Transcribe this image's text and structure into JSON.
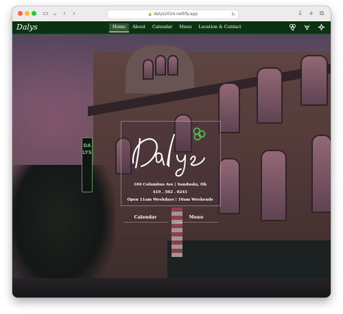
{
  "browser": {
    "url": "dalys2024.netlify.app",
    "icons": {
      "sidebar": "sidebar-icon",
      "back": "chevron-left-icon",
      "forward": "chevron-right-icon",
      "reload": "reload-icon",
      "download": "download-icon",
      "new_tab": "plus-icon",
      "tabs": "tabs-icon"
    }
  },
  "site": {
    "logo": "Dalys",
    "nav": [
      {
        "label": "Home",
        "active": true
      },
      {
        "label": "About",
        "active": false
      },
      {
        "label": "Calendar",
        "active": false
      },
      {
        "label": "Menu",
        "active": false
      },
      {
        "label": "Location & Contact",
        "active": false
      }
    ],
    "nav_icons": [
      "clover-icon",
      "lobster-icon",
      "sparkle-icon"
    ],
    "hero": {
      "address_line1": "104 Columbus Ave | Sandusky, Oh",
      "phone": "419 . 502 . 0241",
      "hours": "Open 11am Weekdays | 10am Weekends",
      "buttons": [
        "Calendar",
        "Menu"
      ],
      "sign_text": "DALYS"
    }
  },
  "colors": {
    "nav_bg": "#0c3311",
    "accent_green": "#4cbb50",
    "text": "#ffffff"
  }
}
